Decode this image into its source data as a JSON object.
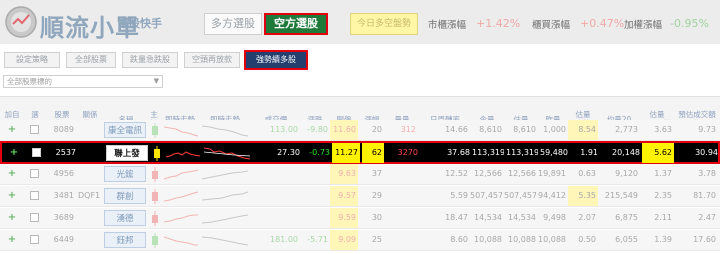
{
  "app": {
    "title": "順流小單",
    "subtitle": "選股快手",
    "mode_tabs": [
      "多方選股",
      "空方選股"
    ],
    "today_label": "今日多空盤勢",
    "stats": [
      {
        "label": "市櫃漲幅",
        "value": "+1.42%",
        "tone": "red"
      },
      {
        "label": "櫃買漲幅",
        "value": "+0.47%",
        "tone": "red"
      },
      {
        "label": "加權漲幅",
        "value": "-0.95%",
        "tone": "green"
      }
    ]
  },
  "filters": {
    "buttons": [
      "設定策略",
      "全部股票",
      "跌量急跌股",
      "空頭再放款"
    ],
    "active": "強勢續多股",
    "dropdown_value": "全部股票標的"
  },
  "table": {
    "headers": [
      "加自\n選股",
      "選\n擇",
      "股票\n代碼",
      "關係\n代碼",
      "名稱",
      "主\n控",
      "即時走勢",
      "即時走勢",
      "成交價",
      "漲跌",
      "開盤",
      "漲幅",
      "量量",
      "日周轉率",
      "今量",
      "估量",
      "昨量",
      "估量\n昨比",
      "均量20",
      "估量\n20MA比",
      "預估成交額\n(億)"
    ],
    "rows": [
      {
        "code": "8089",
        "rel": "",
        "name": "康全電訊",
        "price": "113.00",
        "change": "-9.80",
        "open": "11.60",
        "pct": "20",
        "vol": "312",
        "turnover": "14.66",
        "today": "8,610",
        "est": "8,610",
        "yest": "1,000",
        "ratio": "8.54",
        "avg20": "2,773",
        "ma_ratio": "3.63",
        "amount": "9.73",
        "dir": "down",
        "selected": false
      },
      {
        "code": "2537",
        "rel": "",
        "name": "聯上發",
        "price": "27.30",
        "change": "-0.73",
        "open": "11.27",
        "pct": "62",
        "vol": "3270",
        "turnover": "37.68",
        "today": "113,319",
        "est": "113,319",
        "yest": "59,480",
        "ratio": "1.91",
        "avg20": "20,148",
        "ma_ratio": "5.62",
        "amount": "30.94",
        "dir": "down",
        "selected": true
      },
      {
        "code": "4956",
        "rel": "",
        "name": "光鋐",
        "price": "",
        "change": "",
        "open": "9.63",
        "pct": "37",
        "vol": "",
        "turnover": "12.52",
        "today": "12,566",
        "est": "12,566",
        "yest": "19,891",
        "ratio": "0.63",
        "avg20": "9,120",
        "ma_ratio": "1.37",
        "amount": "3.78",
        "dir": "up",
        "selected": false
      },
      {
        "code": "3481",
        "rel": "DQF1",
        "name": "群創",
        "price": "",
        "change": "",
        "open": "9.57",
        "pct": "29",
        "vol": "",
        "turnover": "5.59",
        "today": "507,457",
        "est": "507,457",
        "yest": "94,412",
        "ratio": "5.35",
        "avg20": "215,549",
        "ma_ratio": "2.35",
        "amount": "81.70",
        "dir": "up",
        "selected": false
      },
      {
        "code": "3689",
        "rel": "",
        "name": "湧德",
        "price": "",
        "change": "",
        "open": "9.59",
        "pct": "30",
        "vol": "",
        "turnover": "18.47",
        "today": "14,534",
        "est": "14,534",
        "yest": "9,498",
        "ratio": "2.07",
        "avg20": "6,875",
        "ma_ratio": "2.11",
        "amount": "2.47",
        "dir": "up",
        "selected": false
      },
      {
        "code": "6449",
        "rel": "",
        "name": "鈺邦",
        "price": "181.00",
        "change": "-5.71",
        "open": "9.09",
        "pct": "25",
        "vol": "",
        "turnover": "8.60",
        "today": "10,088",
        "est": "10,088",
        "yest": "10,088",
        "ratio": "0.50",
        "avg20": "6,055",
        "ma_ratio": "1.39",
        "amount": "17.60",
        "dir": "down",
        "selected": false
      }
    ]
  }
}
